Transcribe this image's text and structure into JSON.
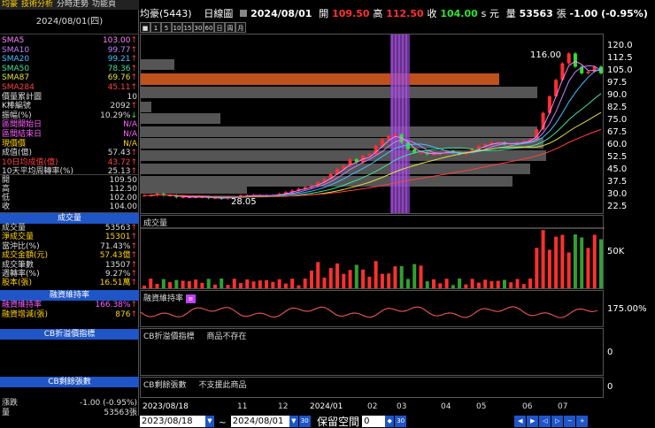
{
  "tabs": [
    "均豪",
    "技術分析",
    "分時走勢",
    "功能頁"
  ],
  "left": {
    "date": "2024/08/01(四)",
    "indicators": [
      {
        "label": "SMA5",
        "value": "103.00",
        "dir": "up",
        "color": "#ff80ff"
      },
      {
        "label": "SMA10",
        "value": "99.77",
        "dir": "up",
        "color": "#c080ff"
      },
      {
        "label": "SMA20",
        "value": "99.21",
        "dir": "up",
        "color": "#40c0ff"
      },
      {
        "label": "SMA50",
        "value": "78.36",
        "dir": "up",
        "color": "#40e0a0"
      },
      {
        "label": "SMA87",
        "value": "69.76",
        "dir": "up",
        "color": "#e0e040"
      },
      {
        "label": "SMA284",
        "value": "45.11",
        "dir": "up",
        "color": "#ff4040"
      },
      {
        "label": "價量累計圖",
        "value": "10",
        "dir": "",
        "color": "#ddd"
      },
      {
        "label": "K棒編號",
        "value": "2092",
        "dir": "up",
        "color": "#ddd"
      },
      {
        "label": "振幅(%)",
        "value": "10.29%",
        "dir": "dn",
        "color": "#ddd"
      },
      {
        "label": "區間開始日",
        "value": "N/A",
        "dir": "",
        "color": "#ff60ff"
      },
      {
        "label": "區間結束日",
        "value": "N/A",
        "dir": "",
        "color": "#ff60ff"
      },
      {
        "label": "現價價",
        "value": "N/A",
        "dir": "",
        "color": "#ffd400"
      },
      {
        "label": "成值(億)",
        "value": "57.43",
        "dir": "up",
        "color": "#ddd"
      },
      {
        "label": "10日均成值(億)",
        "value": "43.72",
        "dir": "up",
        "color": "#ff4040"
      },
      {
        "label": "10天平均周轉率(%)",
        "value": "25.13",
        "dir": "up",
        "color": "#ddd"
      }
    ],
    "ohlc": [
      {
        "label": "開",
        "value": "109.50"
      },
      {
        "label": "高",
        "value": "112.50"
      },
      {
        "label": "低",
        "value": "102.00"
      },
      {
        "label": "收",
        "value": "104.00"
      }
    ],
    "vol_title": "成交量",
    "vol_rows": [
      {
        "label": "成交量",
        "value": "53563",
        "dir": "up",
        "color": "#ddd"
      },
      {
        "label": "淨成交量",
        "value": "15301",
        "dir": "up",
        "color": "#ffd400"
      },
      {
        "label": "當沖比(%)",
        "value": "71.43%",
        "dir": "up",
        "color": "#ddd"
      },
      {
        "label": "成交金額(元)",
        "value": "57.43億",
        "dir": "up",
        "color": "#ffd400"
      },
      {
        "label": "成交筆數",
        "value": "13507",
        "dir": "up",
        "color": "#ddd"
      },
      {
        "label": "週轉率(%)",
        "value": "9.27%",
        "dir": "up",
        "color": "#ddd"
      },
      {
        "label": "股本(張)",
        "value": "16.51萬",
        "dir": "up",
        "color": "#ffd400"
      }
    ],
    "margin_title": "融資維持率",
    "margin_rows": [
      {
        "label": "融資維持率",
        "value": "166.38%",
        "dir": "up",
        "color": "#ff60ff"
      },
      {
        "label": "融資增減(張)",
        "value": "876",
        "dir": "up",
        "color": "#ffd400"
      }
    ],
    "cb1_title": "CB折溢價指標",
    "cb2_title": "CB剩餘張數",
    "bottom_rows": [
      {
        "label": "漲跌",
        "value": "-1.00 (-0.95%)"
      },
      {
        "label": "量",
        "value": "53563張"
      }
    ]
  },
  "header": {
    "stock": "均豪(5443)",
    "chart_name": "日線圖",
    "date": "2024/08/01",
    "open_label": "開",
    "open": "109.50",
    "high_label": "高",
    "high": "112.50",
    "close_label": "收",
    "close": "104.00",
    "unit": "s 元",
    "vol_label": "量",
    "vol": "53563",
    "vol_unit": "張",
    "change": "-1.00 (-0.95%)"
  },
  "toolbar": [
    "1",
    "5",
    "10",
    "15",
    "30",
    "60",
    "日",
    "周",
    "月"
  ],
  "price_axis": [
    "120.0",
    "112.5",
    "105.0",
    "97.5",
    "90.0",
    "82.5",
    "75.0",
    "67.5",
    "60.0",
    "52.5",
    "45.0",
    "37.5",
    "30.0",
    "22.5"
  ],
  "annotations": {
    "high": "116.00",
    "low": "28.05"
  },
  "vol_panel": {
    "title": "成交量",
    "axis_label": "50K"
  },
  "margin_panel": {
    "title": "融資維持率",
    "axis_label": "175.00%"
  },
  "cb1_panel": {
    "title": "CB折溢價指標",
    "note": "商品不存在",
    "axis_label": "0"
  },
  "cb2_panel": {
    "title": "CB剩餘張數",
    "note": "不支援此商品",
    "axis_label": "0"
  },
  "x_axis": [
    "2023/08/18",
    "11",
    "12",
    "2024/01",
    "02",
    "03",
    "04",
    "05",
    "06",
    "07"
  ],
  "bottom": {
    "from": "2023/08/18",
    "to": "2024/08/01",
    "tilde": "~",
    "space_label": "保留空間",
    "space_value": "0"
  },
  "colors": {
    "up": "#ff3030",
    "down": "#30e030",
    "accent": "#1f55c7",
    "highlight": "#8a3fbf",
    "profile": "#555555",
    "profile_max": "#c0501c"
  },
  "chart_data": {
    "type": "candlestick",
    "title": "均豪(5443) 日線圖",
    "ylim": [
      22.5,
      120.0
    ],
    "yticks": [
      22.5,
      30.0,
      37.5,
      45.0,
      52.5,
      60.0,
      67.5,
      75.0,
      82.5,
      90.0,
      97.5,
      105.0,
      112.5,
      120.0
    ],
    "xticks": [
      "2023/08/18",
      "11",
      "12",
      "2024/01",
      "02",
      "03",
      "04",
      "05",
      "06",
      "07"
    ],
    "close_series": [
      30,
      30,
      31,
      30,
      30,
      29,
      29,
      29,
      29,
      29,
      28.5,
      28.5,
      28.05,
      29,
      29,
      30,
      30,
      30,
      30,
      30,
      30,
      31,
      32,
      33,
      34,
      35,
      36,
      38,
      40,
      43,
      46,
      48,
      52,
      50,
      54,
      55,
      60,
      64,
      66,
      67,
      62,
      58,
      56,
      56,
      55,
      55,
      56,
      57,
      56,
      55,
      56,
      58,
      60,
      61,
      62,
      62,
      61,
      61,
      62,
      63,
      64,
      70,
      80,
      90,
      100,
      110,
      116,
      108,
      104,
      105,
      108,
      104
    ]
  }
}
